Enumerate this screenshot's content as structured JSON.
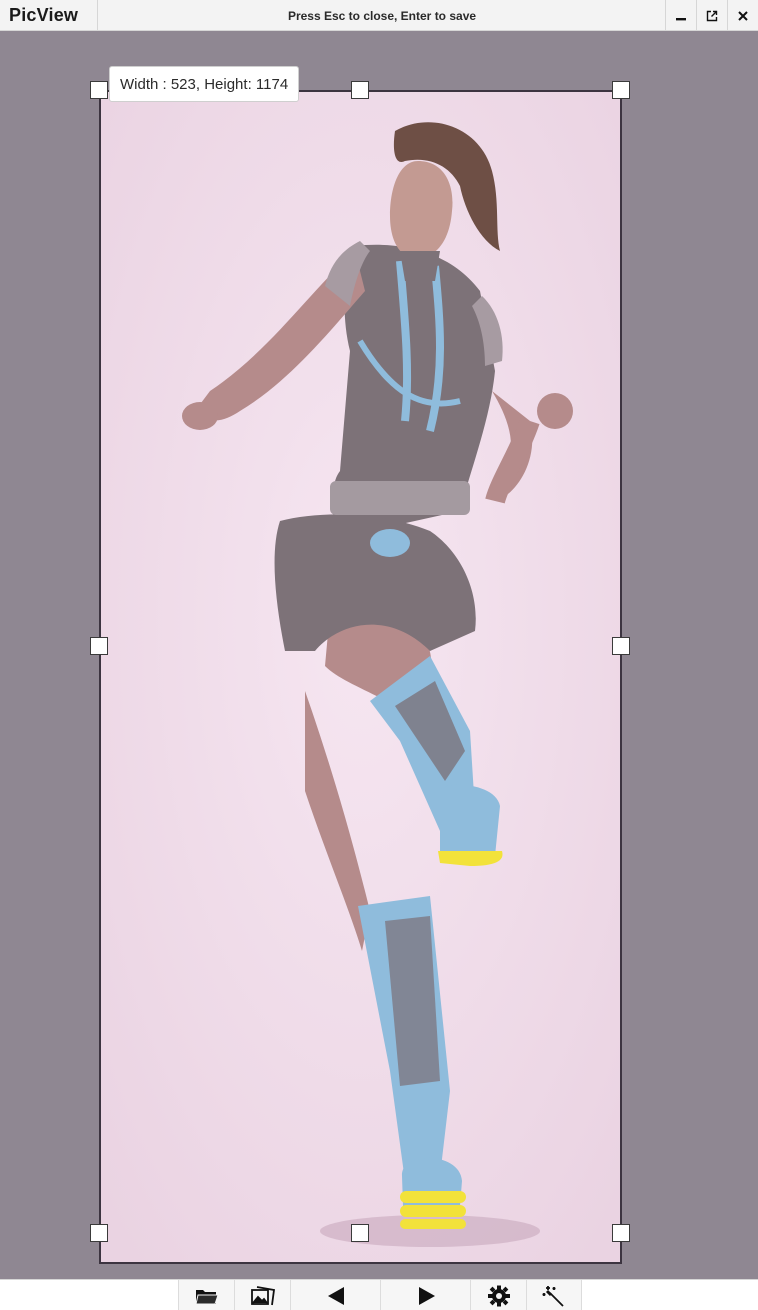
{
  "app": {
    "title": "PicView",
    "hint": "Press Esc to close, Enter to save"
  },
  "window_controls": [
    {
      "name": "minimize-icon"
    },
    {
      "name": "fullscreen-icon"
    },
    {
      "name": "close-icon"
    }
  ],
  "crop": {
    "size_label": "Width : 523, Height: 1174"
  },
  "toolbar": {
    "buttons": [
      {
        "name": "open-folder-icon"
      },
      {
        "name": "gallery-icon"
      },
      {
        "name": "previous-icon"
      },
      {
        "name": "next-icon"
      },
      {
        "name": "settings-icon"
      },
      {
        "name": "magic-wand-icon"
      }
    ]
  },
  "colors": {
    "canvas": "#8f8792",
    "photo_background": "#f2dfec",
    "outfit": "#7d7278",
    "accent_blue": "#8fbcdc",
    "accent_yellow": "#f2e23a"
  }
}
